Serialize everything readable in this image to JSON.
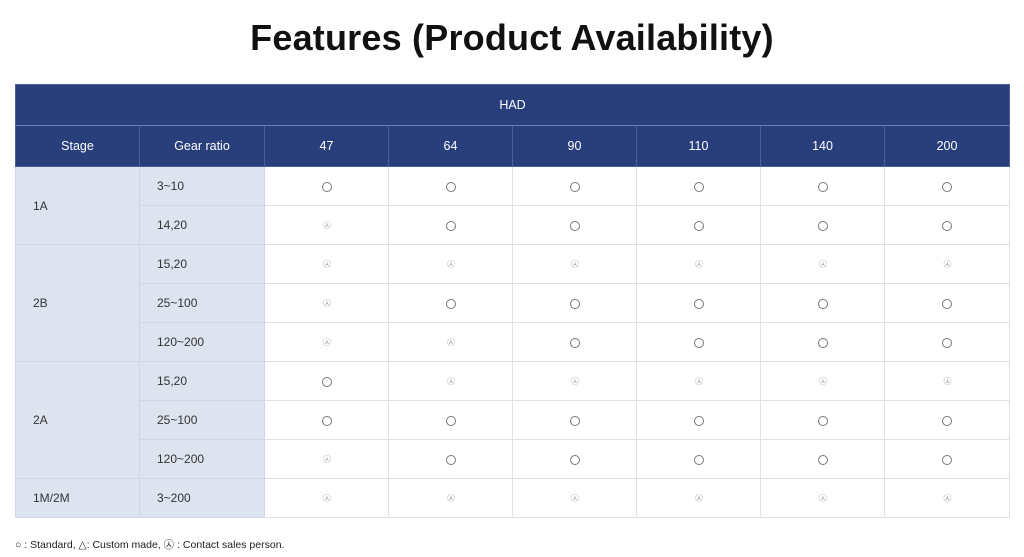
{
  "title": "Features (Product Availability)",
  "table": {
    "group_header": "HAD",
    "columns": [
      "Stage",
      "Gear ratio",
      "47",
      "64",
      "90",
      "110",
      "140",
      "200"
    ],
    "marks": {
      "standard": "○",
      "contact": "㉦"
    },
    "rows": [
      {
        "stage": "1A",
        "rowspan": 2,
        "ratio": "3~10",
        "cells": [
          "standard",
          "standard",
          "standard",
          "standard",
          "standard",
          "standard"
        ]
      },
      {
        "ratio": "14,20",
        "cells": [
          "contact",
          "standard",
          "standard",
          "standard",
          "standard",
          "standard"
        ]
      },
      {
        "stage": "2B",
        "rowspan": 3,
        "ratio": "15,20",
        "cells": [
          "contact",
          "contact",
          "contact",
          "contact",
          "contact",
          "contact"
        ]
      },
      {
        "ratio": "25~100",
        "cells": [
          "contact",
          "standard",
          "standard",
          "standard",
          "standard",
          "standard"
        ]
      },
      {
        "ratio": "120~200",
        "cells": [
          "contact",
          "contact",
          "standard",
          "standard",
          "standard",
          "standard"
        ]
      },
      {
        "stage": "2A",
        "rowspan": 3,
        "ratio": "15,20",
        "cells": [
          "standard",
          "contact",
          "contact",
          "contact",
          "contact",
          "contact"
        ]
      },
      {
        "ratio": "25~100",
        "cells": [
          "standard",
          "standard",
          "standard",
          "standard",
          "standard",
          "standard"
        ]
      },
      {
        "ratio": "120~200",
        "cells": [
          "contact",
          "standard",
          "standard",
          "standard",
          "standard",
          "standard"
        ]
      },
      {
        "stage": "1M/2M",
        "rowspan": 1,
        "ratio": "3~200",
        "cells": [
          "contact",
          "contact",
          "contact",
          "contact",
          "contact",
          "contact"
        ]
      }
    ]
  },
  "legend": "○ : Standard, △: Custom made, ㉦ : Contact sales person.",
  "colors": {
    "header_bg": "#283f7c",
    "stub_bg": "#dde4ef"
  }
}
